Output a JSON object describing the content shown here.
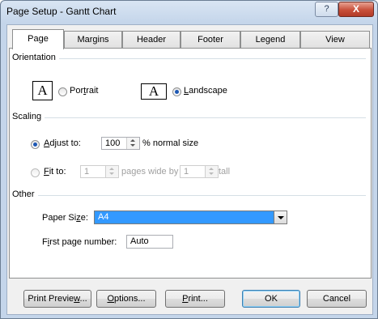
{
  "window": {
    "title": "Page Setup - Gantt Chart",
    "help_label": "?",
    "close_label": "X"
  },
  "tabs": [
    {
      "label": "Page",
      "active": true
    },
    {
      "label": "Margins",
      "active": false
    },
    {
      "label": "Header",
      "active": false
    },
    {
      "label": "Footer",
      "active": false
    },
    {
      "label": "Legend",
      "active": false
    },
    {
      "label": "View",
      "active": false
    }
  ],
  "orientation": {
    "group_label": "Orientation",
    "icon_glyph": "A",
    "portrait": {
      "pre": "Por",
      "accel": "t",
      "post": "rait",
      "selected": false
    },
    "landscape": {
      "pre": "",
      "accel": "L",
      "post": "andscape",
      "selected": true
    }
  },
  "scaling": {
    "group_label": "Scaling",
    "adjust": {
      "pre": "",
      "accel": "A",
      "post": "djust to:",
      "selected": true,
      "value": "100",
      "suffix": "% normal size"
    },
    "fit": {
      "pre": "",
      "accel": "F",
      "post": "it to:",
      "selected": false,
      "wide_value": "1",
      "wide_label": "pages wide by",
      "tall_value": "1",
      "tall_label": "tall"
    }
  },
  "other": {
    "group_label": "Other",
    "paper_size": {
      "pre": "Paper Si",
      "accel": "z",
      "post": "e:",
      "value": "A4"
    },
    "first_page": {
      "pre": "F",
      "accel": "i",
      "post": "rst page number:",
      "value": "Auto"
    }
  },
  "buttons": {
    "print_preview": {
      "pre": "Print Previe",
      "accel": "w",
      "post": "..."
    },
    "options": {
      "pre": "",
      "accel": "O",
      "post": "ptions..."
    },
    "print": {
      "pre": "",
      "accel": "P",
      "post": "rint..."
    },
    "ok": "OK",
    "cancel": "Cancel"
  }
}
